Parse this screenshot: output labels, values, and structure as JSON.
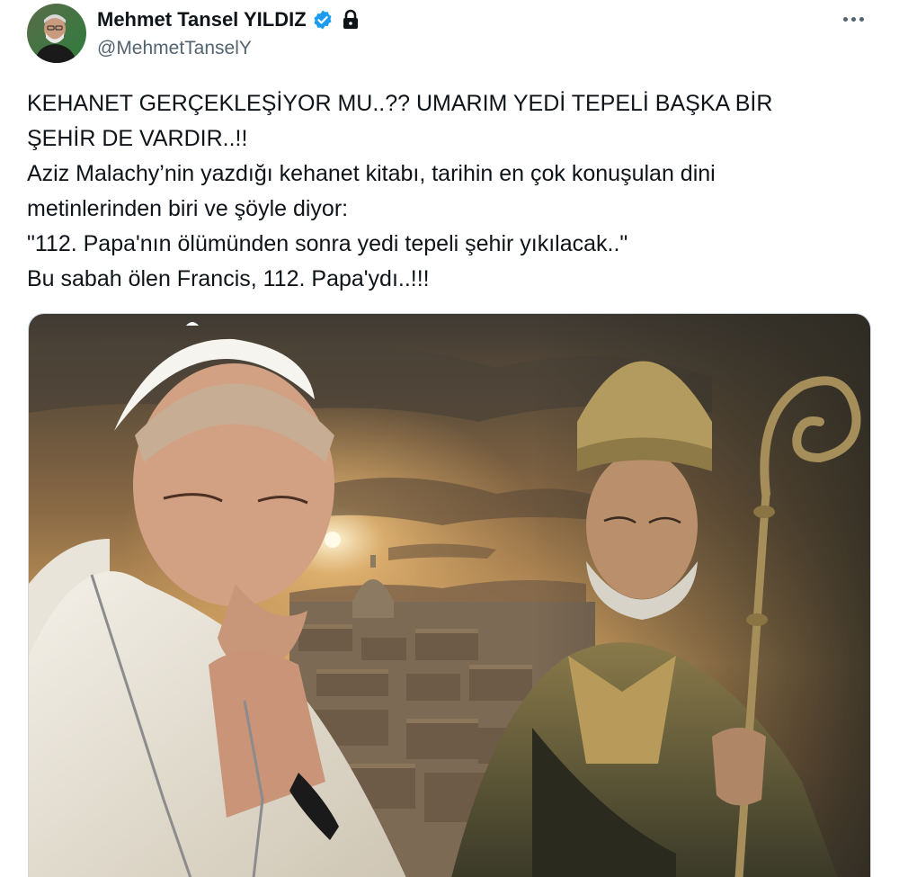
{
  "author": {
    "display_name": "Mehmet Tansel YILDIZ",
    "handle": "@MehmetTanselY",
    "verified": true,
    "protected": true
  },
  "tweet": {
    "lines": [
      "KEHANET GERÇEKLEŞİYOR MU..?? UMARIM YEDİ TEPELİ BAŞKA BİR",
      "ŞEHİR DE VARDIR..!!",
      "Aziz Malachy’nin yazdığı kehanet kitabı, tarihin en çok konuşulan dini",
      "metinlerinden biri ve şöyle diyor:",
      "\"112. Papa'nın ölümünden sonra yedi tepeli şehir yıkılacak..\"",
      "Bu sabah ölen Francis, 112. Papa'ydı..!!!"
    ]
  },
  "icons": {
    "verified": "verified-badge-icon",
    "lock": "lock-icon",
    "more": "more-dots-icon"
  },
  "colors": {
    "text": "#0f1419",
    "secondary": "#536471",
    "verified_blue": "#1d9bf0",
    "border": "#cfd9de"
  }
}
